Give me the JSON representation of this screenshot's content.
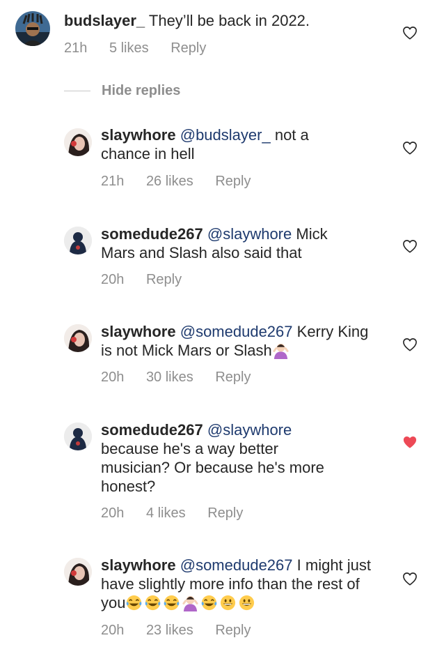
{
  "comments": [
    {
      "username": "budslayer_",
      "mention": "",
      "text": "They’ll be back in 2022.",
      "time": "21h",
      "likes": "5 likes",
      "reply_label": "Reply",
      "liked": false,
      "avatar": "budslayer-avatar"
    },
    {
      "username": "slaywhore",
      "mention": "@budslayer_",
      "text": "not a chance in hell",
      "time": "21h",
      "likes": "26 likes",
      "reply_label": "Reply",
      "liked": false,
      "avatar": "slaywhore-avatar"
    },
    {
      "username": "somedude267",
      "mention": "@slaywhore",
      "text": "Mick Mars and Slash also said that",
      "time": "20h",
      "likes": "",
      "reply_label": "Reply",
      "liked": false,
      "avatar": "somedude267-avatar"
    },
    {
      "username": "slaywhore",
      "mention": "@somedude267",
      "text": "Kerry King is not Mick Mars or Slash",
      "time": "20h",
      "likes": "30 likes",
      "reply_label": "Reply",
      "liked": false,
      "avatar": "slaywhore-avatar",
      "trailing_emoji": [
        "person-shrugging-emoji"
      ]
    },
    {
      "username": "somedude267",
      "mention": "@slaywhore",
      "text": "because he's a way better musician? Or because he's more honest?",
      "time": "20h",
      "likes": "4 likes",
      "reply_label": "Reply",
      "liked": true,
      "avatar": "somedude267-avatar"
    },
    {
      "username": "slaywhore",
      "mention": "@somedude267",
      "text": "I might just have slightly more info than the rest of you",
      "time": "20h",
      "likes": "23 likes",
      "reply_label": "Reply",
      "liked": false,
      "avatar": "slaywhore-avatar",
      "trailing_emoji": [
        "tears-of-joy-emoji",
        "tears-of-joy-emoji",
        "tears-of-joy-emoji",
        "person-shrugging-emoji",
        "tears-of-joy-emoji",
        "grinning-emoji",
        "grinning-emoji"
      ]
    }
  ],
  "hide_replies_label": "Hide replies",
  "colors": {
    "text": "#262626",
    "meta": "#8e8e8e",
    "mention": "#1e3a6e",
    "liked_heart": "#ed4956"
  }
}
